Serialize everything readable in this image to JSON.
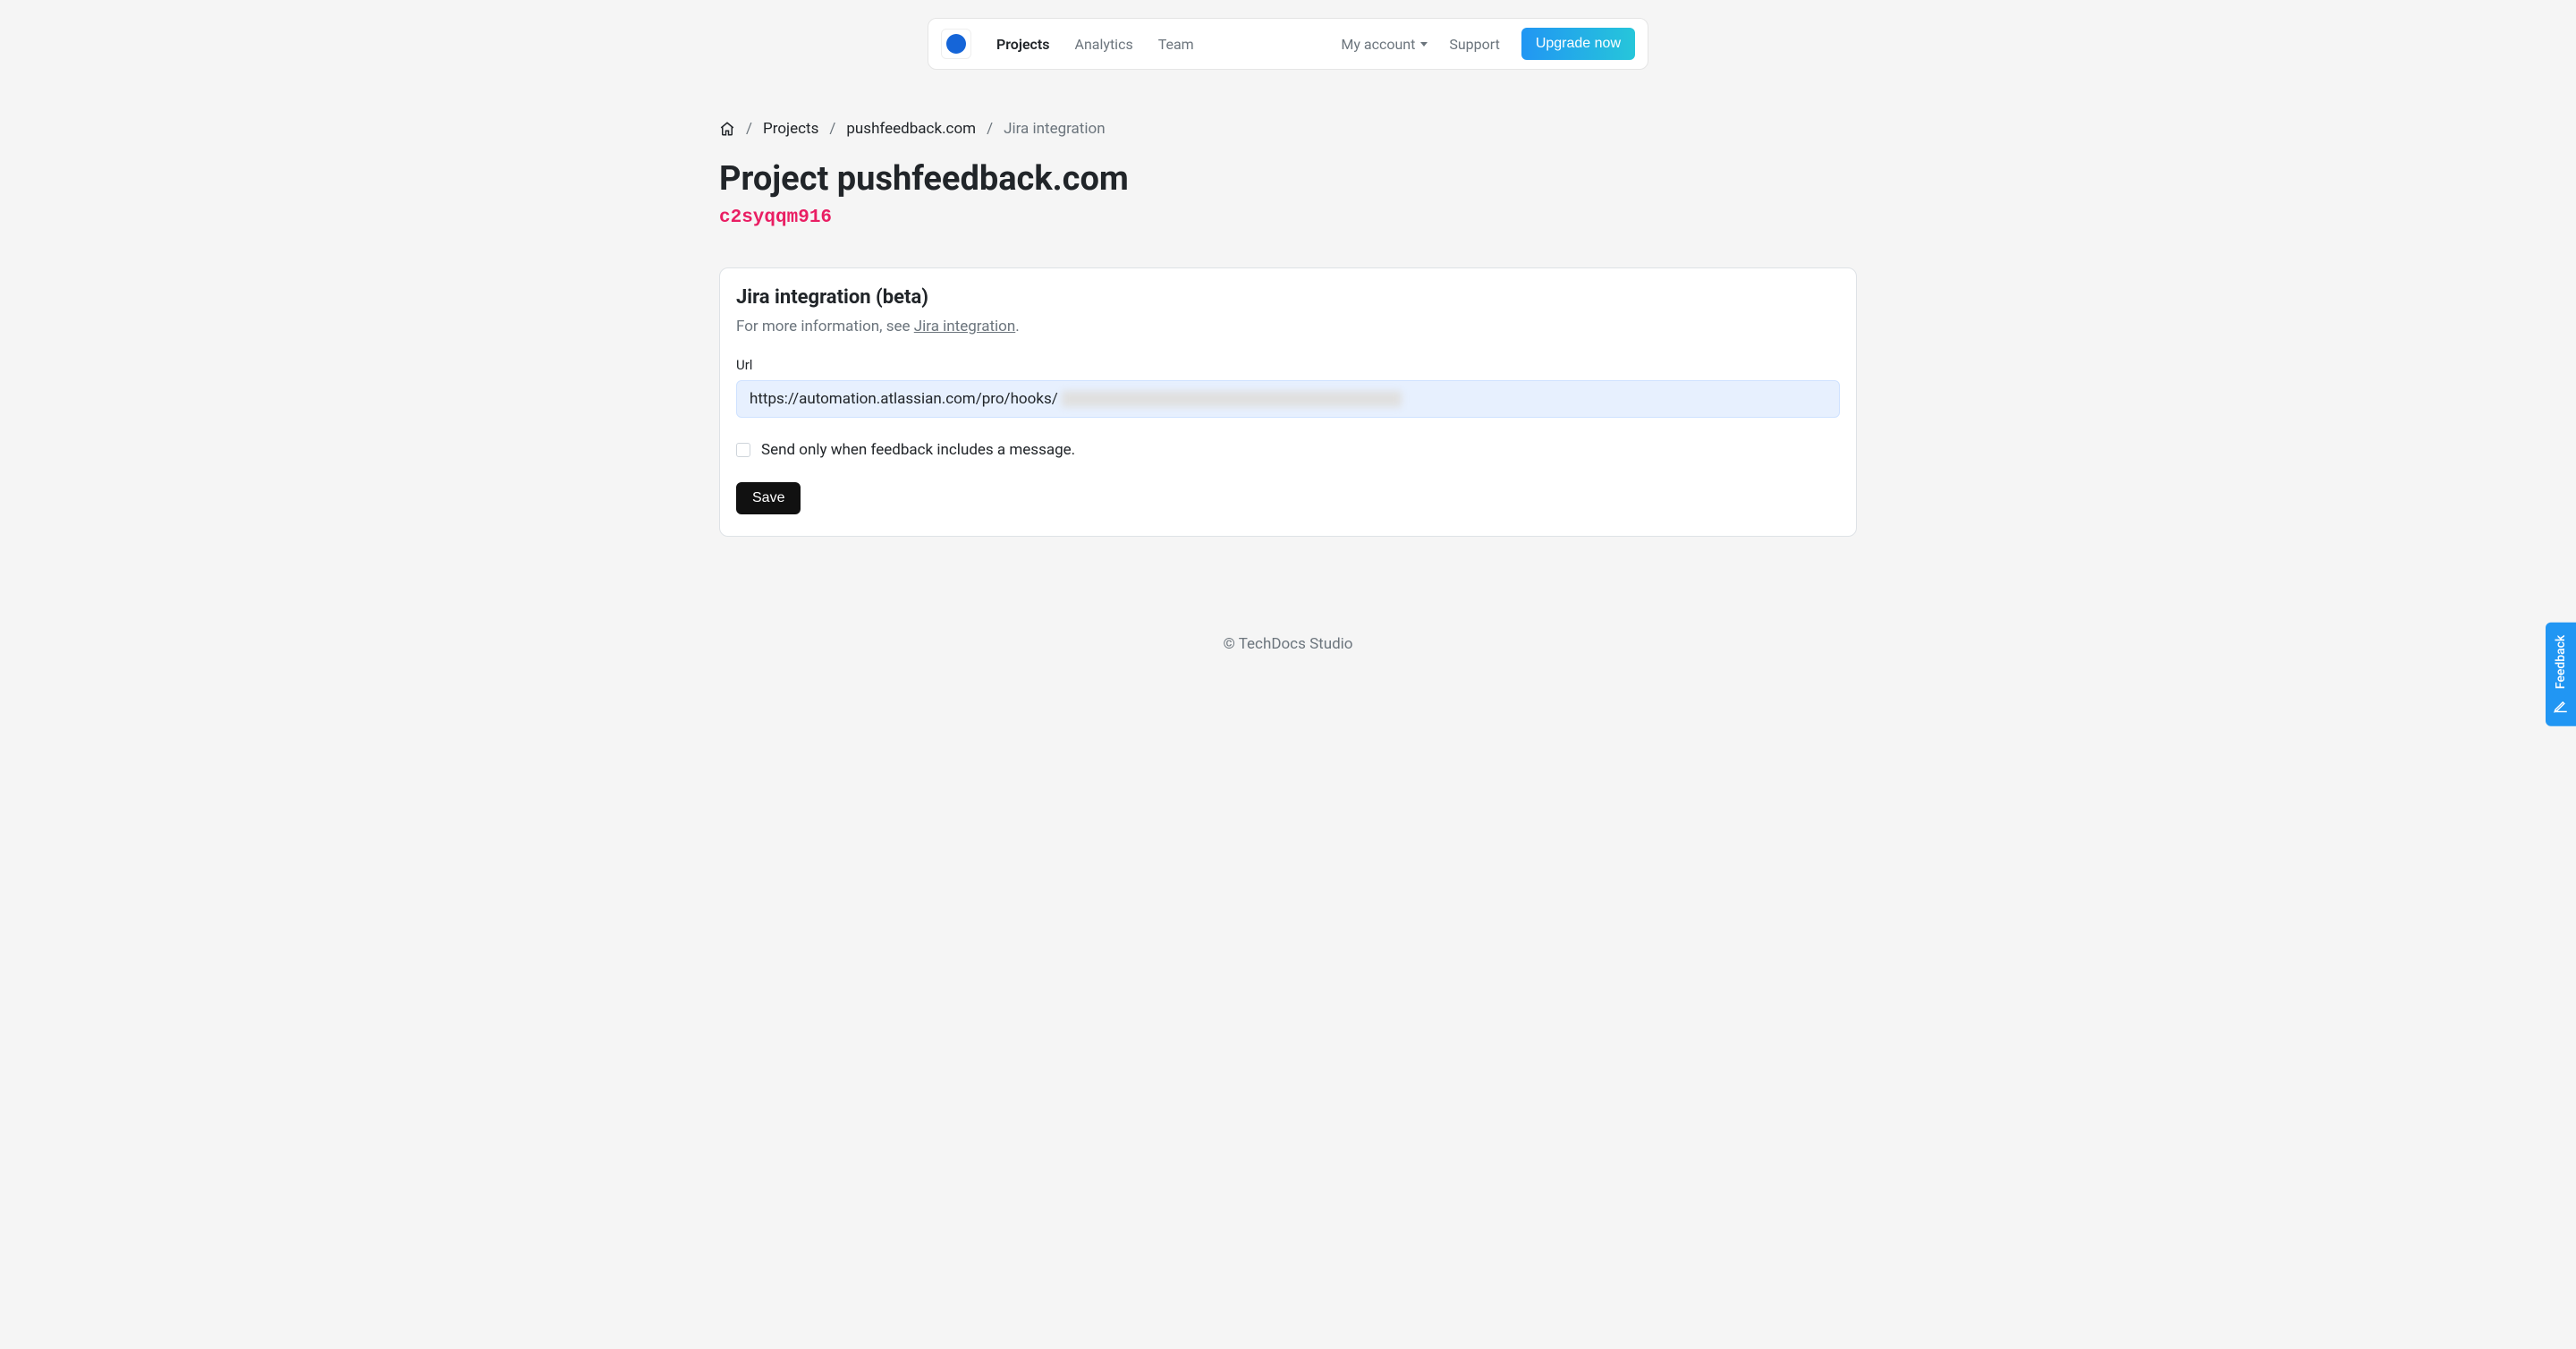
{
  "nav": {
    "projects": "Projects",
    "analytics": "Analytics",
    "team": "Team",
    "account": "My account",
    "support": "Support",
    "upgrade": "Upgrade now"
  },
  "breadcrumb": {
    "projects": "Projects",
    "project_name": "pushfeedback.com",
    "current": "Jira integration"
  },
  "page": {
    "title": "Project pushfeedback.com",
    "project_id": "c2syqqm916"
  },
  "card": {
    "title": "Jira integration (beta)",
    "desc_prefix": "For more information, see ",
    "desc_link": "Jira integration",
    "desc_suffix": ".",
    "url_label": "Url",
    "url_value": "https://automation.atlassian.com/pro/hooks/",
    "checkbox_label": "Send only when feedback includes a message.",
    "save": "Save"
  },
  "footer": {
    "text": "© TechDocs Studio"
  },
  "feedback": {
    "label": "Feedback"
  }
}
